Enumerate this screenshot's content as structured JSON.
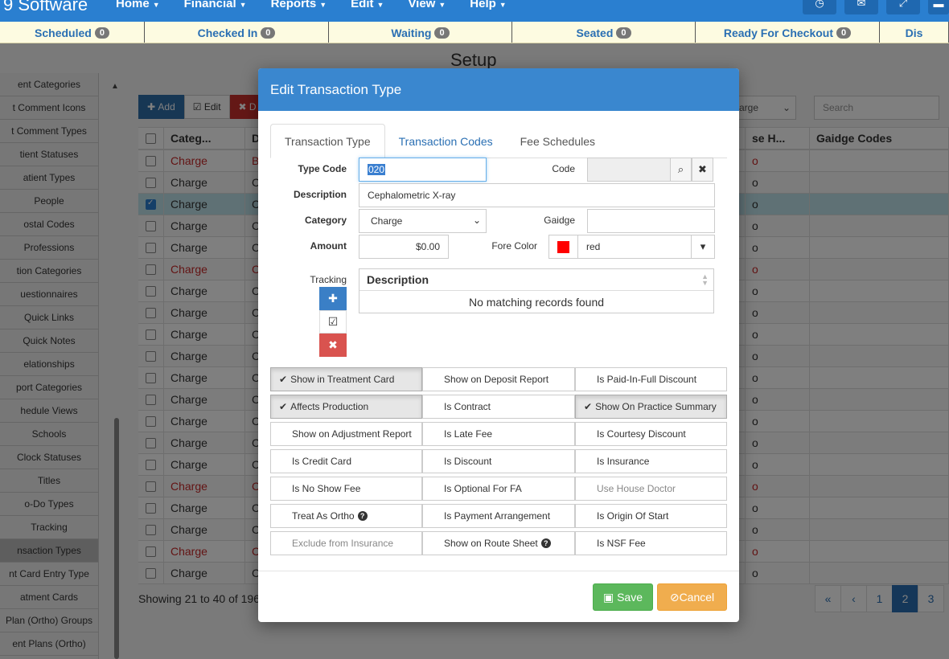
{
  "nav": {
    "brand": "9 Software",
    "menus": [
      "Home",
      "Financial",
      "Reports",
      "Edit",
      "View",
      "Help"
    ]
  },
  "statusbar": [
    {
      "label": "Scheduled",
      "count": "0"
    },
    {
      "label": "Checked In",
      "count": "0"
    },
    {
      "label": "Waiting",
      "count": "0"
    },
    {
      "label": "Seated",
      "count": "0"
    },
    {
      "label": "Ready For Checkout",
      "count": "0"
    },
    {
      "label": "Dis",
      "count": ""
    }
  ],
  "page": {
    "title": "Setup"
  },
  "sidebar": {
    "items": [
      "ent Categories",
      "t Comment Icons",
      "t Comment Types",
      "tient Statuses",
      "atient Types",
      "People",
      "ostal Codes",
      "Professions",
      "tion Categories",
      "uestionnaires",
      "Quick Links",
      "Quick Notes",
      "elationships",
      "port Categories",
      "hedule Views",
      "Schools",
      "Clock Statuses",
      "Titles",
      "o-Do Types",
      "Tracking",
      "nsaction Types",
      "nt Card Entry Type",
      "atment Cards",
      "Plan (Ortho) Groups",
      "ent Plans (Ortho)"
    ],
    "active_index": 20
  },
  "grid": {
    "toolbar": {
      "add": "Add",
      "edit": "Edit",
      "delete": "D"
    },
    "filter_value": "arge",
    "search_placeholder": "Search",
    "columns": [
      "Categ...",
      "D",
      "se H...",
      "Gaidge Codes"
    ],
    "rows": [
      {
        "category": "Charge",
        "d": "B",
        "h": "o",
        "red": true,
        "selected": false
      },
      {
        "category": "Charge",
        "d": "C",
        "h": "o",
        "red": false,
        "selected": false
      },
      {
        "category": "Charge",
        "d": "C",
        "h": "o",
        "red": false,
        "selected": true
      },
      {
        "category": "Charge",
        "d": "C",
        "h": "o",
        "red": false,
        "selected": false
      },
      {
        "category": "Charge",
        "d": "C",
        "h": "o",
        "red": false,
        "selected": false
      },
      {
        "category": "Charge",
        "d": "C",
        "h": "o",
        "red": true,
        "selected": false
      },
      {
        "category": "Charge",
        "d": "C",
        "h": "o",
        "red": false,
        "selected": false
      },
      {
        "category": "Charge",
        "d": "C",
        "h": "o",
        "red": false,
        "selected": false
      },
      {
        "category": "Charge",
        "d": "C",
        "h": "o",
        "red": false,
        "selected": false
      },
      {
        "category": "Charge",
        "d": "C",
        "h": "o",
        "red": false,
        "selected": false
      },
      {
        "category": "Charge",
        "d": "C",
        "h": "o",
        "red": false,
        "selected": false
      },
      {
        "category": "Charge",
        "d": "C",
        "h": "o",
        "red": false,
        "selected": false
      },
      {
        "category": "Charge",
        "d": "C",
        "h": "o",
        "red": false,
        "selected": false
      },
      {
        "category": "Charge",
        "d": "C",
        "h": "o",
        "red": false,
        "selected": false
      },
      {
        "category": "Charge",
        "d": "C",
        "h": "o",
        "red": false,
        "selected": false
      },
      {
        "category": "Charge",
        "d": "C",
        "h": "o",
        "red": true,
        "selected": false
      },
      {
        "category": "Charge",
        "d": "C",
        "h": "o",
        "red": false,
        "selected": false
      },
      {
        "category": "Charge",
        "d": "C",
        "h": "o",
        "red": false,
        "selected": false
      },
      {
        "category": "Charge",
        "d": "C",
        "h": "o",
        "red": true,
        "selected": false
      },
      {
        "category": "Charge",
        "d": "C",
        "h": "o",
        "red": false,
        "selected": false
      }
    ],
    "showing": "Showing 21 to 40 of 196",
    "pager": [
      "«",
      "‹",
      "1",
      "2",
      "3"
    ],
    "active_page": "2"
  },
  "modal": {
    "title": "Edit Transaction Type",
    "tabs": [
      "Transaction Type",
      "Transaction Codes",
      "Fee Schedules"
    ],
    "fields": {
      "type_code_label": "Type Code",
      "type_code_value": "020",
      "code_label": "Code",
      "code_value": "",
      "description_label": "Description",
      "description_value": "Cephalometric X-ray",
      "category_label": "Category",
      "category_value": "Charge",
      "gaidge_label": "Gaidge",
      "gaidge_value": "",
      "amount_label": "Amount",
      "amount_value": "$0.00",
      "fore_color_label": "Fore Color",
      "fore_color_value": "red",
      "fore_color_hex": "#ff0000",
      "tracking_label": "Tracking"
    },
    "tracking_table": {
      "header": "Description",
      "empty": "No matching records found"
    },
    "flags": [
      {
        "label": "Show in Treatment Card",
        "on": true,
        "disabled": false,
        "help": false
      },
      {
        "label": "Show on Deposit Report",
        "on": false,
        "disabled": false,
        "help": false
      },
      {
        "label": "Is Paid-In-Full Discount",
        "on": false,
        "disabled": false,
        "help": false
      },
      {
        "label": "Affects Production",
        "on": true,
        "disabled": false,
        "help": false
      },
      {
        "label": "Is Contract",
        "on": false,
        "disabled": false,
        "help": false
      },
      {
        "label": "Show On Practice Summary",
        "on": true,
        "disabled": false,
        "help": false
      },
      {
        "label": "Show on Adjustment Report",
        "on": false,
        "disabled": false,
        "help": false
      },
      {
        "label": "Is Late Fee",
        "on": false,
        "disabled": false,
        "help": false
      },
      {
        "label": "Is Courtesy Discount",
        "on": false,
        "disabled": false,
        "help": false
      },
      {
        "label": "Is Credit Card",
        "on": false,
        "disabled": false,
        "help": false
      },
      {
        "label": "Is Discount",
        "on": false,
        "disabled": false,
        "help": false
      },
      {
        "label": "Is Insurance",
        "on": false,
        "disabled": false,
        "help": false
      },
      {
        "label": "Is No Show Fee",
        "on": false,
        "disabled": false,
        "help": false
      },
      {
        "label": "Is Optional For FA",
        "on": false,
        "disabled": false,
        "help": false
      },
      {
        "label": "Use House Doctor",
        "on": false,
        "disabled": true,
        "help": false
      },
      {
        "label": "Treat As Ortho",
        "on": false,
        "disabled": false,
        "help": true
      },
      {
        "label": "Is Payment Arrangement",
        "on": false,
        "disabled": false,
        "help": false
      },
      {
        "label": "Is Origin Of Start",
        "on": false,
        "disabled": false,
        "help": false
      },
      {
        "label": "Exclude from Insurance",
        "on": false,
        "disabled": true,
        "help": false
      },
      {
        "label": "Show on Route Sheet",
        "on": false,
        "disabled": false,
        "help": true
      },
      {
        "label": "Is NSF Fee",
        "on": false,
        "disabled": false,
        "help": false
      }
    ],
    "save_label": "Save",
    "cancel_label": "Cancel"
  }
}
